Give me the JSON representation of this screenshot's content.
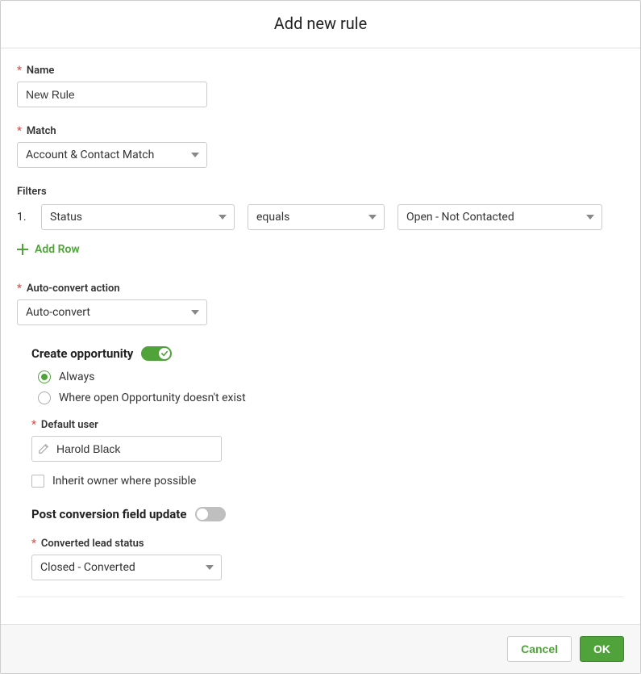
{
  "header": {
    "title": "Add new rule"
  },
  "fields": {
    "name": {
      "label": "Name",
      "value": "New Rule"
    },
    "match": {
      "label": "Match",
      "value": "Account & Contact Match"
    },
    "filters_label": "Filters",
    "filters": [
      {
        "index": "1.",
        "field": "Status",
        "op": "equals",
        "value": "Open - Not Contacted"
      }
    ],
    "add_row_label": "Add Row",
    "auto_convert_action": {
      "label": "Auto-convert action",
      "value": "Auto-convert"
    },
    "create_opportunity": {
      "heading": "Create opportunity",
      "toggle_on": true,
      "options": {
        "always": "Always",
        "where_open": "Where open Opportunity doesn't exist"
      },
      "selected": "always"
    },
    "default_user": {
      "label": "Default user",
      "value": "Harold Black"
    },
    "inherit_owner": {
      "label": "Inherit owner where possible",
      "checked": false
    },
    "post_conversion": {
      "heading": "Post conversion field update",
      "toggle_on": false
    },
    "converted_lead_status": {
      "label": "Converted lead status",
      "value": "Closed - Converted"
    }
  },
  "footer": {
    "cancel": "Cancel",
    "ok": "OK"
  }
}
